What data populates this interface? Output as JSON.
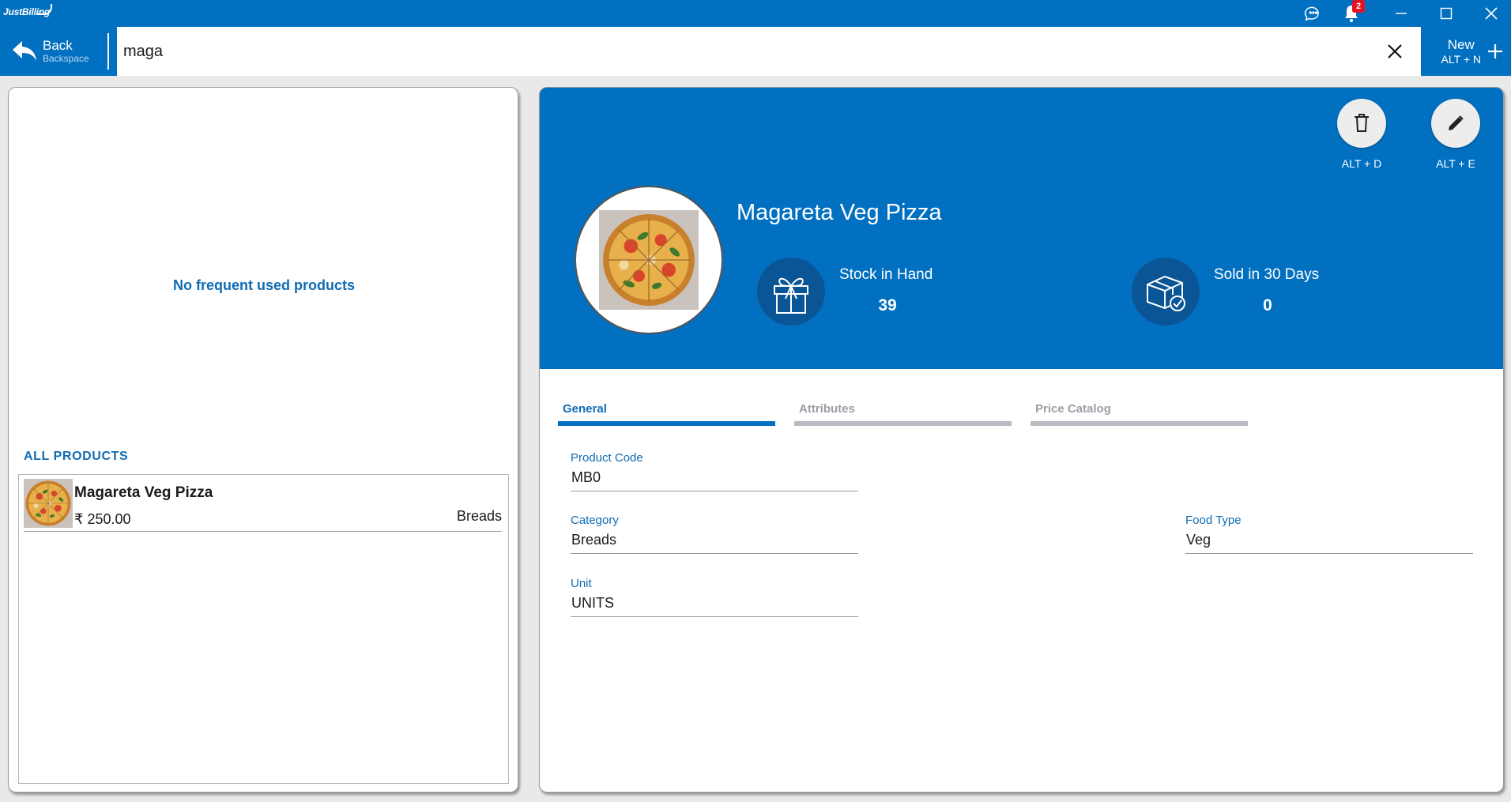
{
  "app": {
    "logo_text": "JustBilling",
    "notification_count": "2"
  },
  "search": {
    "back_label": "Back",
    "back_hint": "Backspace",
    "query": "maga",
    "new_label": "New",
    "new_hint": "ALT + N"
  },
  "left": {
    "empty_frequent": "No frequent used products",
    "all_products_heading": "ALL PRODUCTS",
    "products": [
      {
        "name": "Magareta Veg Pizza",
        "price": "₹ 250.00",
        "category": "Breads"
      }
    ]
  },
  "detail": {
    "delete_hint": "ALT + D",
    "edit_hint": "ALT + E",
    "product_name": "Magareta Veg Pizza",
    "stock_label": "Stock in Hand",
    "stock_value": "39",
    "sold_label": "Sold in 30 Days",
    "sold_value": "0",
    "tabs": [
      {
        "label": "General",
        "active": true
      },
      {
        "label": "Attributes",
        "active": false
      },
      {
        "label": "Price Catalog",
        "active": false
      }
    ],
    "fields": {
      "product_code": {
        "label": "Product Code",
        "value": "MB0"
      },
      "category": {
        "label": "Category",
        "value": "Breads"
      },
      "food_type": {
        "label": "Food Type",
        "value": "Veg"
      },
      "unit": {
        "label": "Unit",
        "value": "UNITS"
      }
    }
  },
  "colors": {
    "brand_blue": "#0270c0",
    "label_blue": "#0f6cb5",
    "stat_circle": "#0a5596",
    "tab_inactive": "#b8bcc2",
    "badge_red": "#e81123"
  },
  "icons": {
    "titlebar": [
      "feedback-icon",
      "bell-icon",
      "minimize-icon",
      "maximize-icon",
      "close-icon"
    ],
    "actions": [
      "back-arrow-icon",
      "clear-icon",
      "plus-icon",
      "trash-icon",
      "pencil-icon",
      "gift-box-icon",
      "package-check-icon"
    ]
  }
}
